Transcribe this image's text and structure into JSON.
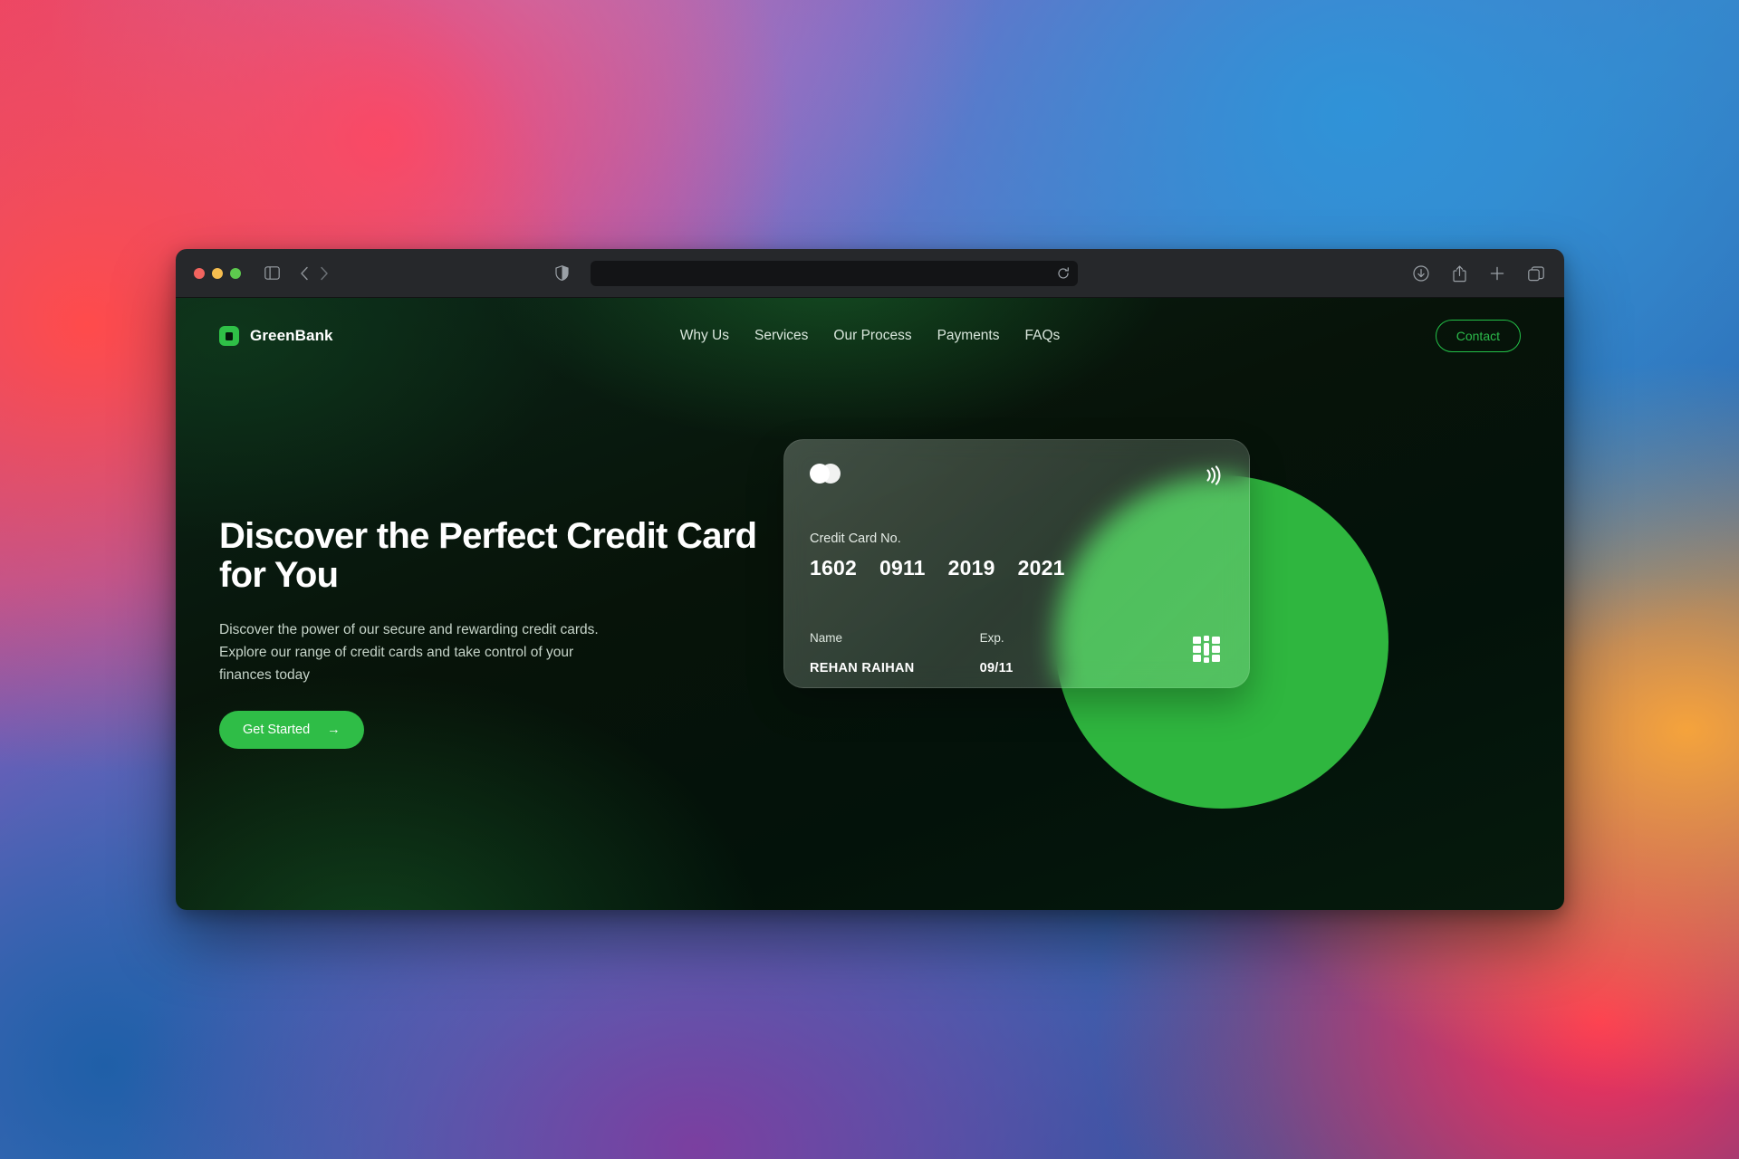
{
  "browser": {
    "traffic_lights": [
      "close",
      "minimize",
      "zoom"
    ],
    "sidebar_toggle_icon": "sidebar-icon",
    "back_icon": "chevron-left-icon",
    "forward_icon": "chevron-right-icon",
    "shield_icon": "privacy-shield-icon",
    "url_value": "",
    "url_placeholder": "",
    "reload_icon": "reload-icon",
    "right_icons": [
      "download-icon",
      "share-icon",
      "new-tab-icon",
      "tab-overview-icon"
    ]
  },
  "site": {
    "brand": {
      "name": "GreenBank",
      "logo_icon": "greenbank-logo-icon",
      "accent_color": "#2fc047"
    },
    "nav": [
      {
        "label": "Why Us"
      },
      {
        "label": "Services"
      },
      {
        "label": "Our Process"
      },
      {
        "label": "Payments"
      },
      {
        "label": "FAQs"
      }
    ],
    "contact_label": "Contact"
  },
  "hero": {
    "title": "Discover the Perfect Credit Card for You",
    "subtitle": "Discover the power of our secure and rewarding credit cards.\nExplore our range of credit cards and take control of your\nfinances today",
    "cta_label": "Get Started",
    "cta_arrow": "→",
    "cta_color": "#2fbd47",
    "circle_color": "#2fb63f"
  },
  "credit_card": {
    "network_logo_icon": "mastercard-logo-icon",
    "contactless_icon": "contactless-nfc-icon",
    "chip_icon": "card-chip-icon",
    "number_label": "Credit Card No.",
    "number_groups": [
      "1602",
      "0911",
      "2019",
      "2021"
    ],
    "name_label": "Name",
    "name_value": "REHAN RAIHAN",
    "exp_label": "Exp.",
    "exp_value": "09/11"
  }
}
